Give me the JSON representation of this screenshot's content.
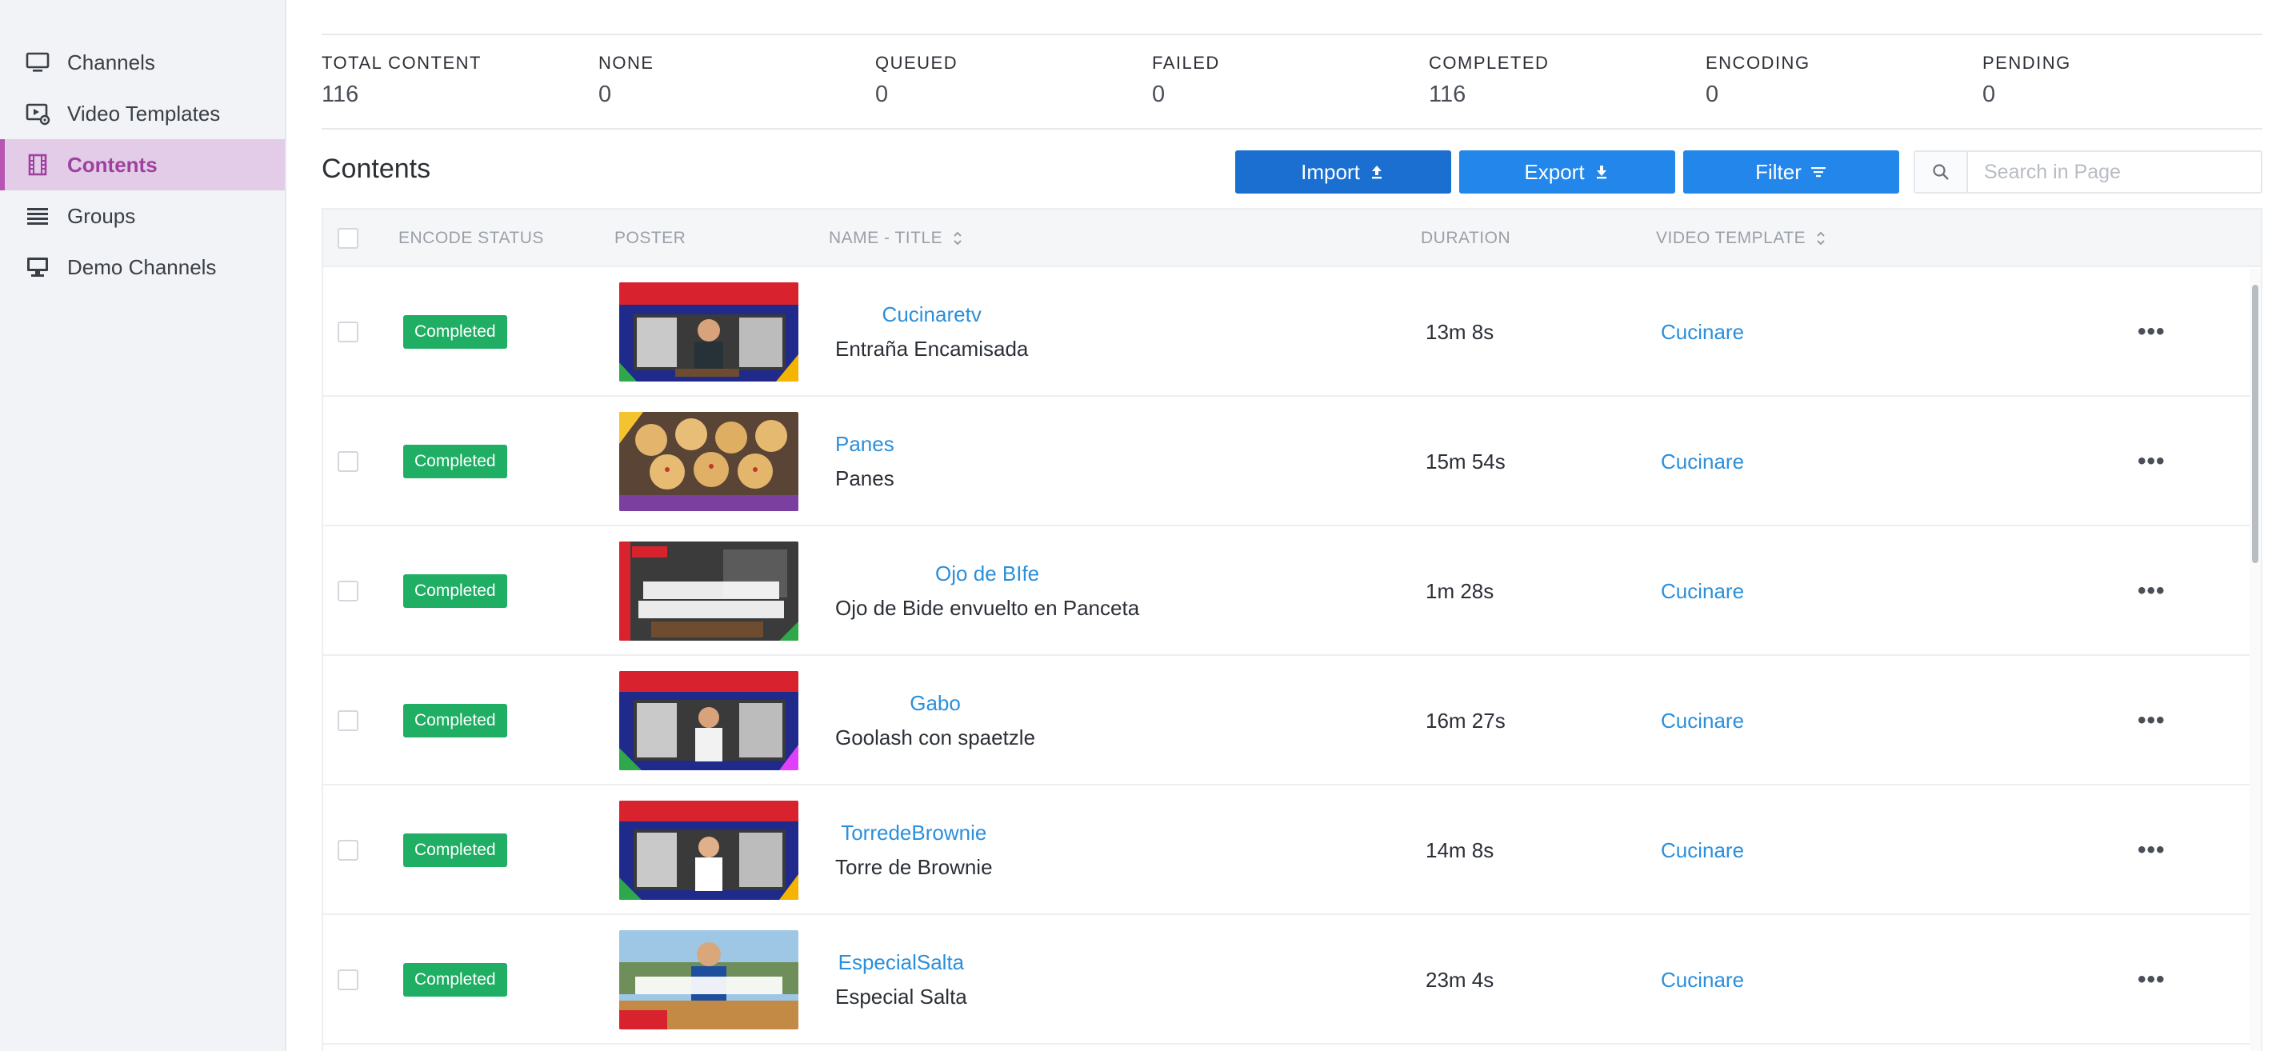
{
  "sidebar": {
    "items": [
      {
        "label": "Channels",
        "icon": "monitor-icon",
        "active": false
      },
      {
        "label": "Video Templates",
        "icon": "video-settings-icon",
        "active": false
      },
      {
        "label": "Contents",
        "icon": "film-icon",
        "active": true
      },
      {
        "label": "Groups",
        "icon": "list-group-icon",
        "active": false
      },
      {
        "label": "Demo Channels",
        "icon": "display-stand-icon",
        "active": false
      }
    ]
  },
  "stats": [
    {
      "label": "TOTAL CONTENT",
      "value": "116"
    },
    {
      "label": "NONE",
      "value": "0"
    },
    {
      "label": "QUEUED",
      "value": "0"
    },
    {
      "label": "FAILED",
      "value": "0"
    },
    {
      "label": "COMPLETED",
      "value": "116"
    },
    {
      "label": "ENCODING",
      "value": "0"
    },
    {
      "label": "PENDING",
      "value": "0"
    }
  ],
  "main": {
    "title": "Contents",
    "import_label": "Import",
    "export_label": "Export",
    "filter_label": "Filter",
    "search_placeholder": "Search in Page"
  },
  "table": {
    "headers": {
      "encode_status": "ENCODE STATUS",
      "poster": "POSTER",
      "name_title": "NAME - TITLE",
      "duration": "DURATION",
      "video_template": "VIDEO TEMPLATE"
    },
    "rows": [
      {
        "status": "Completed",
        "name": "Cucinaretv",
        "title": "Entraña Encamisada",
        "duration": "13m 8s",
        "template": "Cucinare"
      },
      {
        "status": "Completed",
        "name": "Panes",
        "title": "Panes",
        "duration": "15m 54s",
        "template": "Cucinare"
      },
      {
        "status": "Completed",
        "name": "Ojo de BIfe",
        "title": "Ojo de Bide envuelto en Panceta",
        "duration": "1m 28s",
        "template": "Cucinare"
      },
      {
        "status": "Completed",
        "name": "Gabo",
        "title": "Goolash con spaetzle",
        "duration": "16m 27s",
        "template": "Cucinare"
      },
      {
        "status": "Completed",
        "name": "TorredeBrownie",
        "title": "Torre de Brownie",
        "duration": "14m 8s",
        "template": "Cucinare"
      },
      {
        "status": "Completed",
        "name": "EspecialSalta",
        "title": "Especial Salta",
        "duration": "23m 4s",
        "template": "Cucinare"
      }
    ]
  },
  "colors": {
    "accent": "#2386ea",
    "import": "#1a6fd0",
    "badge": "#1fae63",
    "link": "#2b8fdb",
    "nav_active": "#a0409e"
  }
}
